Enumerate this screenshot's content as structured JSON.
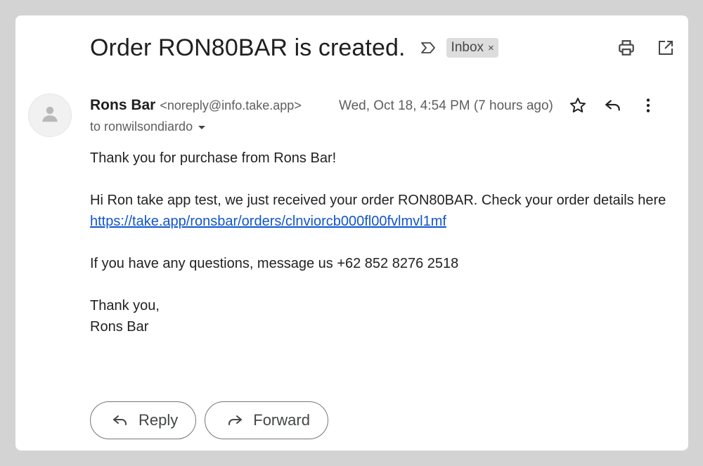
{
  "email": {
    "subject": "Order RON80BAR is created.",
    "label": "Inbox",
    "label_remove": "×",
    "sender_name": "Rons Bar",
    "sender_email": "<noreply@info.take.app>",
    "date": "Wed, Oct 18, 4:54 PM (7 hours ago)",
    "recipient": "to ronwilsondiardo",
    "body": {
      "line1": "Thank you for purchase from Rons Bar!",
      "line2": "Hi Ron take app test, we just received your order RON80BAR. Check your order details here",
      "link": "https://take.app/ronsbar/orders/clnviorcb000fl00fvlmvl1mf",
      "line3": "If you have any questions, message us +62 852 8276 2518",
      "sign1": "Thank you,",
      "sign2": "Rons Bar"
    }
  },
  "actions": {
    "reply_label": "Reply",
    "forward_label": "Forward"
  },
  "icons": {
    "important": "important-marker-icon",
    "print": "print-icon",
    "open_new_window": "open-in-new-window-icon",
    "star": "star-icon",
    "reply": "reply-icon",
    "more": "more-vertical-icon",
    "avatar": "person-icon"
  },
  "colors": {
    "background": "#d3d3d3",
    "link": "#1155cc",
    "chip": "#dddddd",
    "secondary_text": "#5e5e5e"
  }
}
